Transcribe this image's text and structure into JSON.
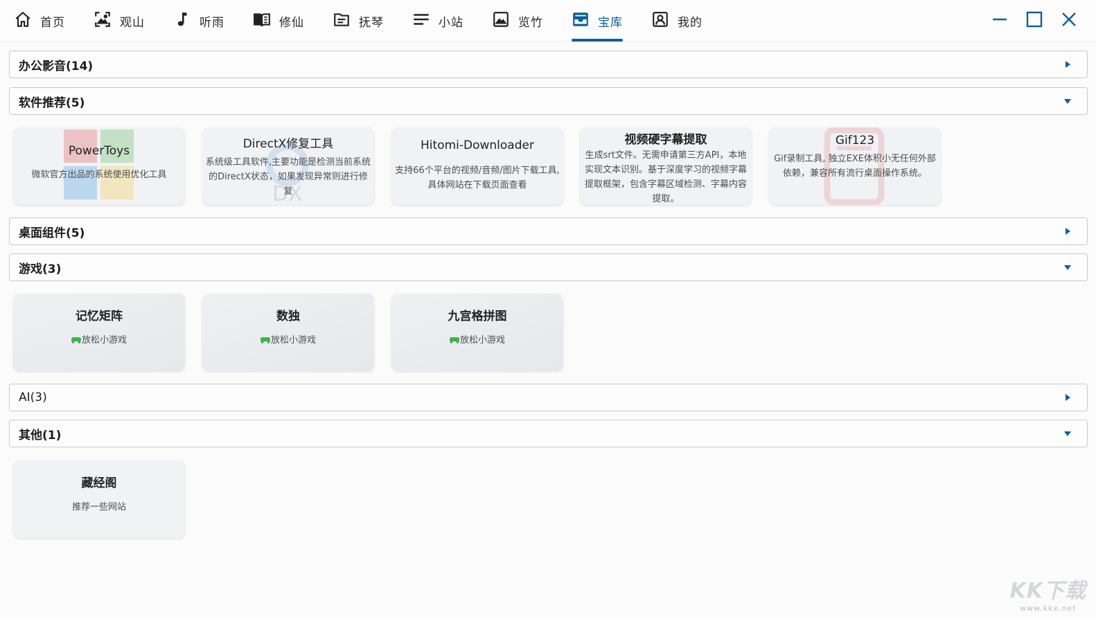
{
  "nav": {
    "items": [
      {
        "label": "首页",
        "icon": "home-icon"
      },
      {
        "label": "观山",
        "icon": "landscape-frame-icon"
      },
      {
        "label": "听雨",
        "icon": "music-note-icon"
      },
      {
        "label": "修仙",
        "icon": "book-icon"
      },
      {
        "label": "抚琴",
        "icon": "folder-text-icon"
      },
      {
        "label": "小站",
        "icon": "lines-icon"
      },
      {
        "label": "览竹",
        "icon": "image-icon"
      },
      {
        "label": "宝库",
        "icon": "inbox-tray-icon",
        "active": true
      },
      {
        "label": "我的",
        "icon": "user-badge-icon"
      }
    ],
    "accent_color": "#0d5f9e"
  },
  "window_controls": {
    "minimize": "minimize-icon",
    "maximize": "maximize-icon",
    "close": "close-icon"
  },
  "sections": [
    {
      "title": "办公影音(14)",
      "expanded": false
    },
    {
      "title": "软件推荐(5)",
      "expanded": true,
      "cards": [
        {
          "title": "PowerToys",
          "desc": "微软官方出品的系统使用优化工具"
        },
        {
          "title": "DirectX修复工具",
          "desc": "系统级工具软件,主要功能是检测当前系统的DirectX状态，如果发现异常则进行修复"
        },
        {
          "title": "Hitomi-Downloader",
          "desc": "支持66个平台的视频/音频/图片下载工具,具体网站在下载页面查看"
        },
        {
          "title": "视频硬字幕提取",
          "desc": "生成srt文件。无需申请第三方API，本地实现文本识别。基于深度学习的视频字幕提取框架，包含字幕区域检测、字幕内容提取。"
        },
        {
          "title": "Gif123",
          "desc": "Gif录制工具, 独立EXE体积小无任何外部依赖，兼容所有流行桌面操作系统。"
        }
      ]
    },
    {
      "title": "桌面组件(5)",
      "expanded": false
    },
    {
      "title": "游戏(3)",
      "expanded": true,
      "cards": [
        {
          "title": "记忆矩阵",
          "desc": "放松小游戏"
        },
        {
          "title": "数独",
          "desc": "放松小游戏"
        },
        {
          "title": "九宫格拼图",
          "desc": "放松小游戏"
        }
      ]
    },
    {
      "title": "AI(3)",
      "expanded": false
    },
    {
      "title": "其他(1)",
      "expanded": true,
      "cards": [
        {
          "title": "藏经阁",
          "desc": "推荐一些网站"
        }
      ]
    }
  ],
  "watermark": {
    "big": "KK下载",
    "small": "www.kkx.net"
  }
}
